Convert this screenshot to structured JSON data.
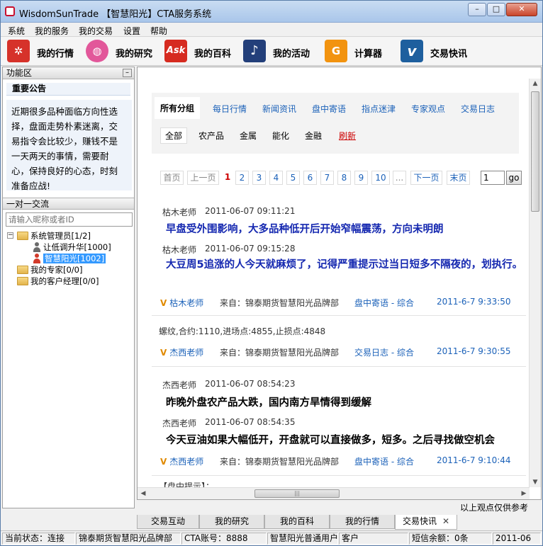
{
  "window": {
    "title": "WisdomSunTrade 【智慧阳光】CTA服务系统",
    "minimize": "–",
    "maximize": "□",
    "close": "✕"
  },
  "menu": [
    "系统",
    "我的服务",
    "我的交易",
    "设置",
    "帮助"
  ],
  "toolbar": [
    {
      "label": "我的行情",
      "icon": "yelp-icon",
      "glyph": "✲",
      "color": "#d6322a"
    },
    {
      "label": "我的研究",
      "icon": "dribbble-icon",
      "glyph": "◍",
      "color": "#e2579a"
    },
    {
      "label": "我的百科",
      "icon": "ask-icon",
      "glyph": "Ask",
      "color": "#d62b20"
    },
    {
      "label": "我的活动",
      "icon": "music-note-icon",
      "glyph": "♪",
      "color": "#233f7a"
    },
    {
      "label": "计算器",
      "icon": "calculator-icon",
      "glyph": "G",
      "color": "#f2930f"
    },
    {
      "label": "交易快讯",
      "icon": "vimeo-icon",
      "glyph": "v",
      "color": "#1e5f9e"
    }
  ],
  "left": {
    "panel_title": "功能区",
    "collapse": "–",
    "notice_title": "重要公告",
    "notice_lines": [
      "近期很多品种面临方向性选",
      "择，盘面走势朴素迷离，交",
      "易指令会比较少，赚钱不是",
      "一天两天的事情，需要耐",
      "心，保持良好的心态，时刻",
      "准备应战!"
    ],
    "chat_title": "一对一交流",
    "search_placeholder": "请输入昵称或者ID",
    "tree": {
      "expander_open": "−",
      "expander_closed": "+",
      "group1": "系统管理员[1/2]",
      "user1": "让低调升华[1000]",
      "user2": "智慧阳光[1002]",
      "group2": "我的专家[0/0]",
      "group3": "我的客户经理[0/0]"
    }
  },
  "filters": {
    "categories": [
      "所有分组",
      "每日行情",
      "新闻资讯",
      "盘中寄语",
      "指点迷津",
      "专家观点",
      "交易日志"
    ],
    "subs": [
      "全部",
      "农产品",
      "金属",
      "能化",
      "金融",
      "刷新"
    ]
  },
  "pager": {
    "first": "首页",
    "prev": "上一页",
    "current": "1",
    "pages": [
      "2",
      "3",
      "4",
      "5",
      "6",
      "7",
      "8",
      "9",
      "10",
      "..."
    ],
    "next": "下一页",
    "last": "末页",
    "input_value": "1",
    "go": "go"
  },
  "posts": [
    {
      "author": "枯木老师",
      "time": "2011-06-07 09:11:21",
      "text": "早盘受外围影响，大多品种低开后开始窄幅震荡，方向未明朗"
    },
    {
      "author": "枯木老师",
      "time": "2011-06-07 09:15:28",
      "text": "大豆周5追涨的人今天就麻烦了，记得严重提示过当日短多不隔夜的，划执行。"
    },
    {
      "author": "杰西老师",
      "time": "2011-06-07 08:54:23",
      "text": "昨晚外盘农产品大跌，国内南方旱情得到缓解"
    },
    {
      "author": "杰西老师",
      "time": "2011-06-07 08:54:35",
      "text": "今天豆油如果大幅低开，开盘就可以直接做多，短多。之后寻找做空机会"
    }
  ],
  "sources": [
    {
      "mark": "V",
      "author": "枯木老师",
      "from": "来自：锦泰期货智慧阳光品牌部",
      "tag": "盘中寄语  -  综合",
      "date": "2011-6-7 9:33:50"
    },
    {
      "mark": "V",
      "author": "杰西老师",
      "from": "来自：锦泰期货智慧阳光品牌部",
      "tag": "交易日志  -  综合",
      "date": "2011-6-7 9:30:55"
    },
    {
      "mark": "V",
      "author": "杰西老师",
      "from": "来自：锦泰期货智慧阳光品牌部",
      "tag": "盘中寄语  -  综合",
      "date": "2011-6-7 9:10:44"
    }
  ],
  "trade_log": "螺纹,合约:1110,进场点:4855,止损点:4848",
  "cut_text": "【盘中提示】：",
  "disclaimer": "以上观点仅供参考",
  "tabs": [
    "交易互动",
    "我的研究",
    "我的百科",
    "我的行情",
    "交易快讯"
  ],
  "tab_close": "✕",
  "status": [
    "当前状态：连接",
    "锦泰期货智慧阳光品牌部",
    "CTA账号：8888",
    "智慧阳光普通用户",
    "客户",
    "短信余额：0条",
    "2011-06"
  ]
}
